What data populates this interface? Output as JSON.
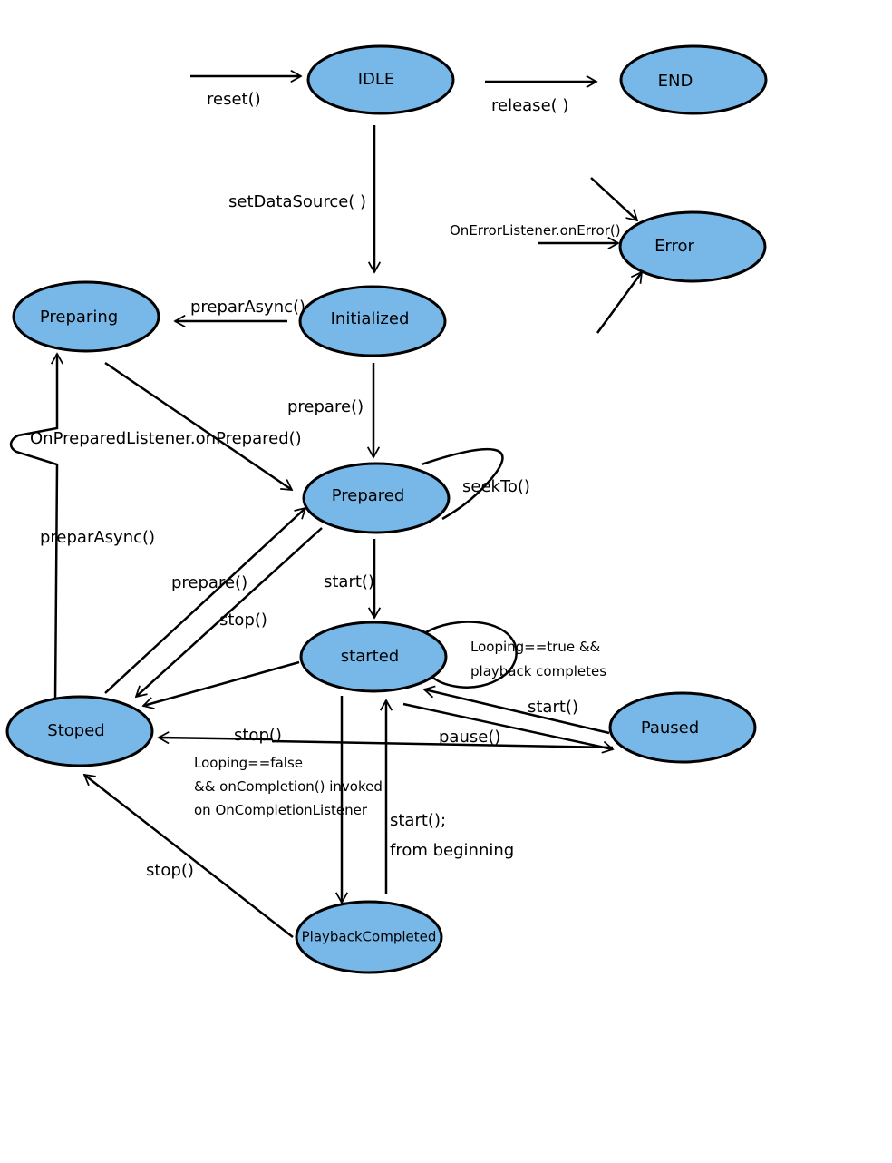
{
  "colors": {
    "node_fill": "#78b8e8",
    "stroke": "#000000"
  },
  "nodes": {
    "idle": "IDLE",
    "end": "END",
    "error": "Error",
    "preparing": "Preparing",
    "initialized": "Initialized",
    "prepared": "Prepared",
    "started": "started",
    "paused": "Paused",
    "stoped": "Stoped",
    "playback_completed": "PlaybackCompleted"
  },
  "edges": {
    "reset": "reset()",
    "release": "release( )",
    "set_data_source": "setDataSource( )",
    "on_error": "OnErrorListener.onError()",
    "prepar_async_init": "preparAsync()",
    "on_prepared": "OnPreparedListener.onPrepared()",
    "prepare_init": "prepare()",
    "seek_to": "seekTo()",
    "start_prepared": "start()",
    "looping_true_1": "Looping==true &&",
    "looping_true_2": "playback completes",
    "prepare_stoped": "prepare()",
    "stop_prepared": "stop()",
    "start_paused": "start()",
    "pause": "pause()",
    "stop_started": "stop()",
    "looping_false_1": "Looping==false",
    "looping_false_2": "&& onCompletion() invoked",
    "looping_false_3": "on OnCompletionListener",
    "start_from_beginning_1": "start();",
    "start_from_beginning_2": "from beginning",
    "stop_completed": "stop()",
    "prepar_async_stoped": "preparAsync()"
  }
}
